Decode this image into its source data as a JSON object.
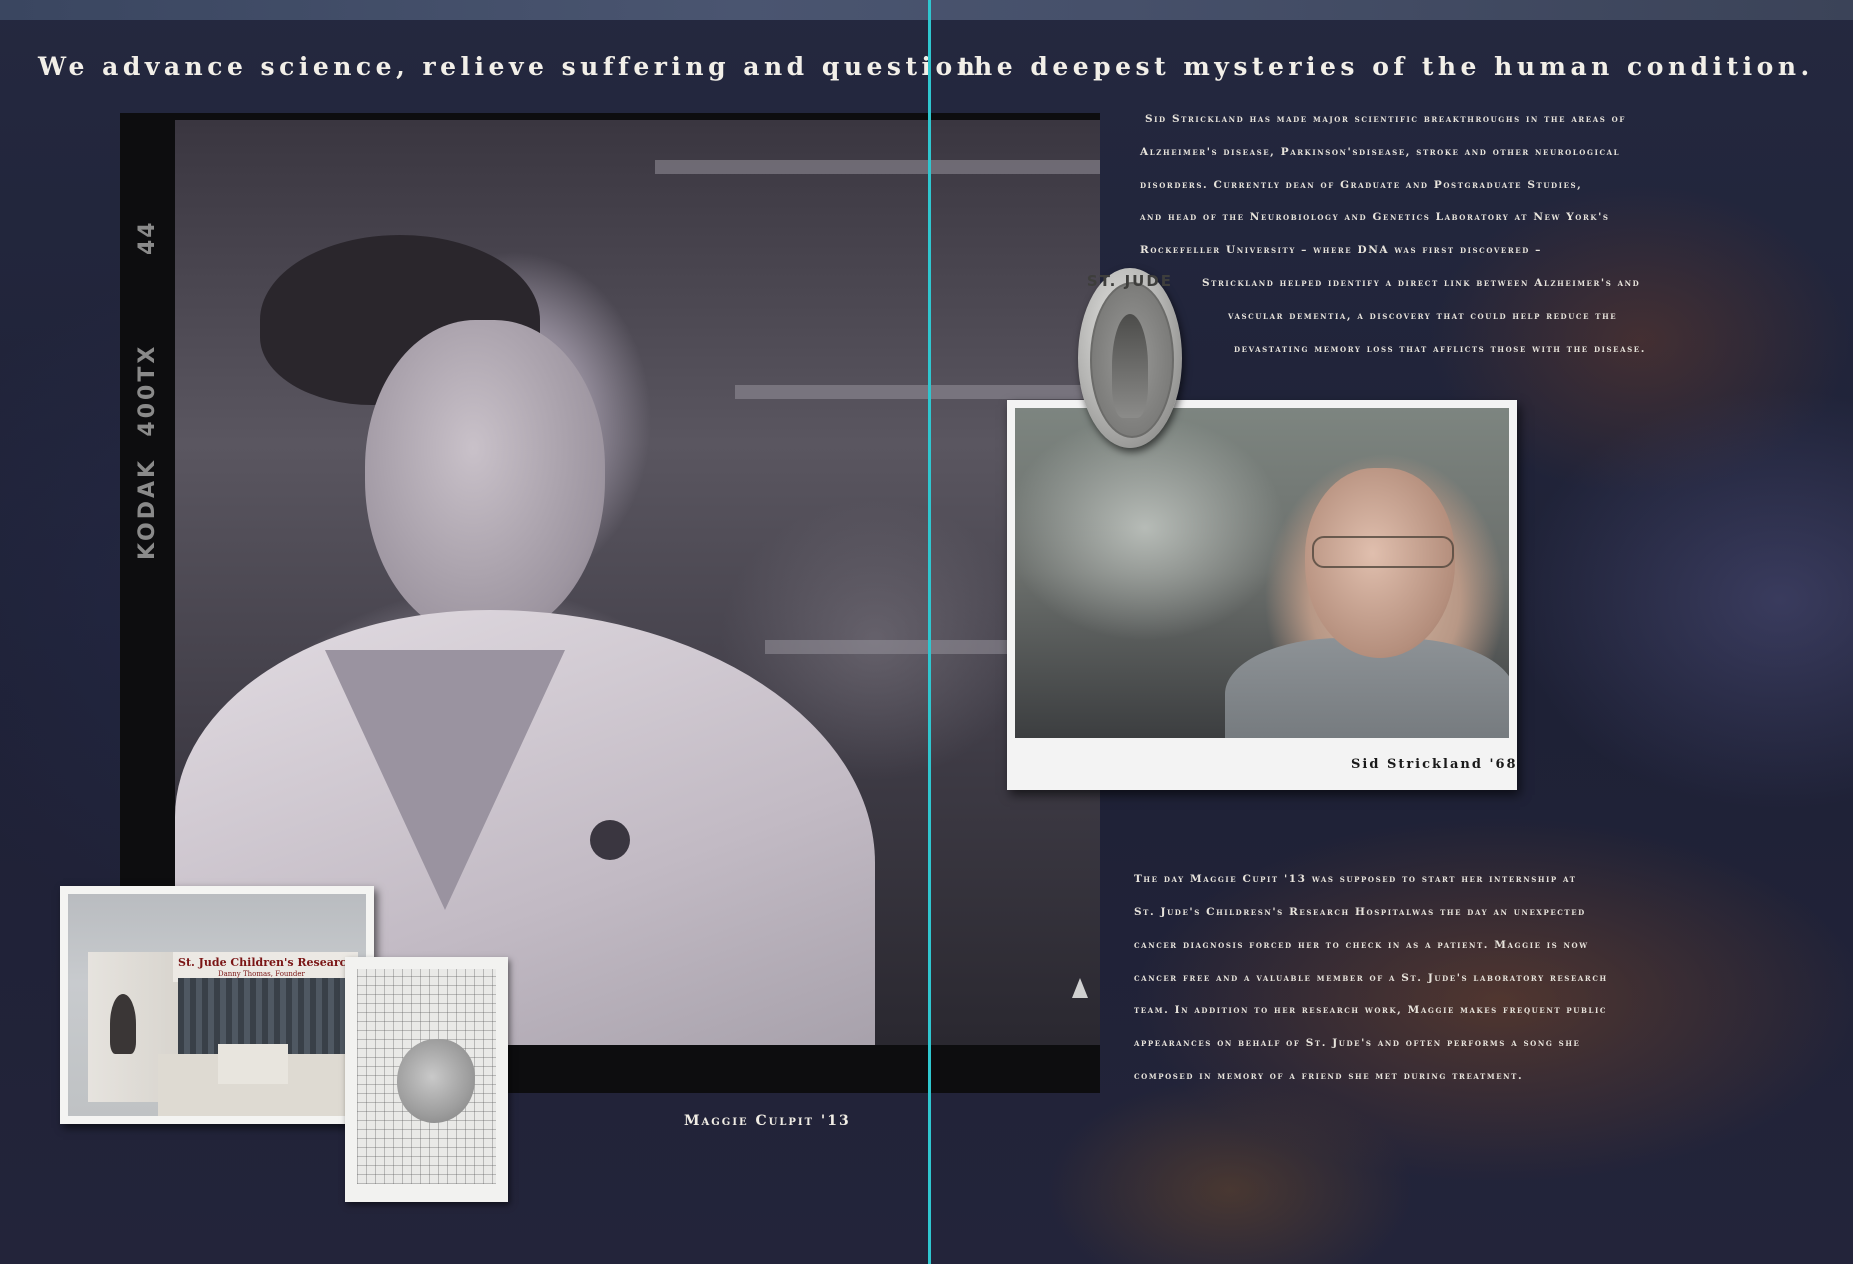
{
  "headline": {
    "left": "We advance science, relieve suffering and question",
    "right": "the deepest mysteries of the human condition."
  },
  "film": {
    "frame_number": "44",
    "brand": "KODAK",
    "stock": "400TX"
  },
  "hospital_photo": {
    "sign": "St. Jude Children's Research Hospital",
    "sign_sub": "Danny Thomas, Founder"
  },
  "medal": {
    "text": "ST. JUDE"
  },
  "captions": {
    "maggie": "Maggie Culpit '13",
    "sid": "Sid Strickland '68"
  },
  "sid_paragraph": [
    "Sid Strickland has made major scientific breakthroughs in the areas of",
    "Alzheimer's disease, Parkinson'sdisease, stroke and other neurological",
    "disorders. Currently dean of Graduate and Postgraduate Studies,",
    "and head of the Neurobiology and Genetics Laboratory at New York's",
    "Rockefeller University – where DNA was first discovered –",
    "Strickland helped identify a direct link between Alzheimer's and",
    "vascular dementia, a discovery that could help reduce the",
    "devastating memory loss that afflicts those with the disease."
  ],
  "maggie_paragraph": [
    "The day Maggie Cupit '13 was supposed to start her internship at",
    "St. Jude's Childresn's Research Hospitalwas the day an unexpected",
    "cancer diagnosis forced her to check in as a patient. Maggie is now",
    "cancer free and a valuable member of a St. Jude's laboratory research",
    "team. In addition to her research work, Maggie makes frequent public",
    "appearances on behalf of St. Jude's and often performs a song she",
    "composed in memory of a friend she met during treatment."
  ]
}
